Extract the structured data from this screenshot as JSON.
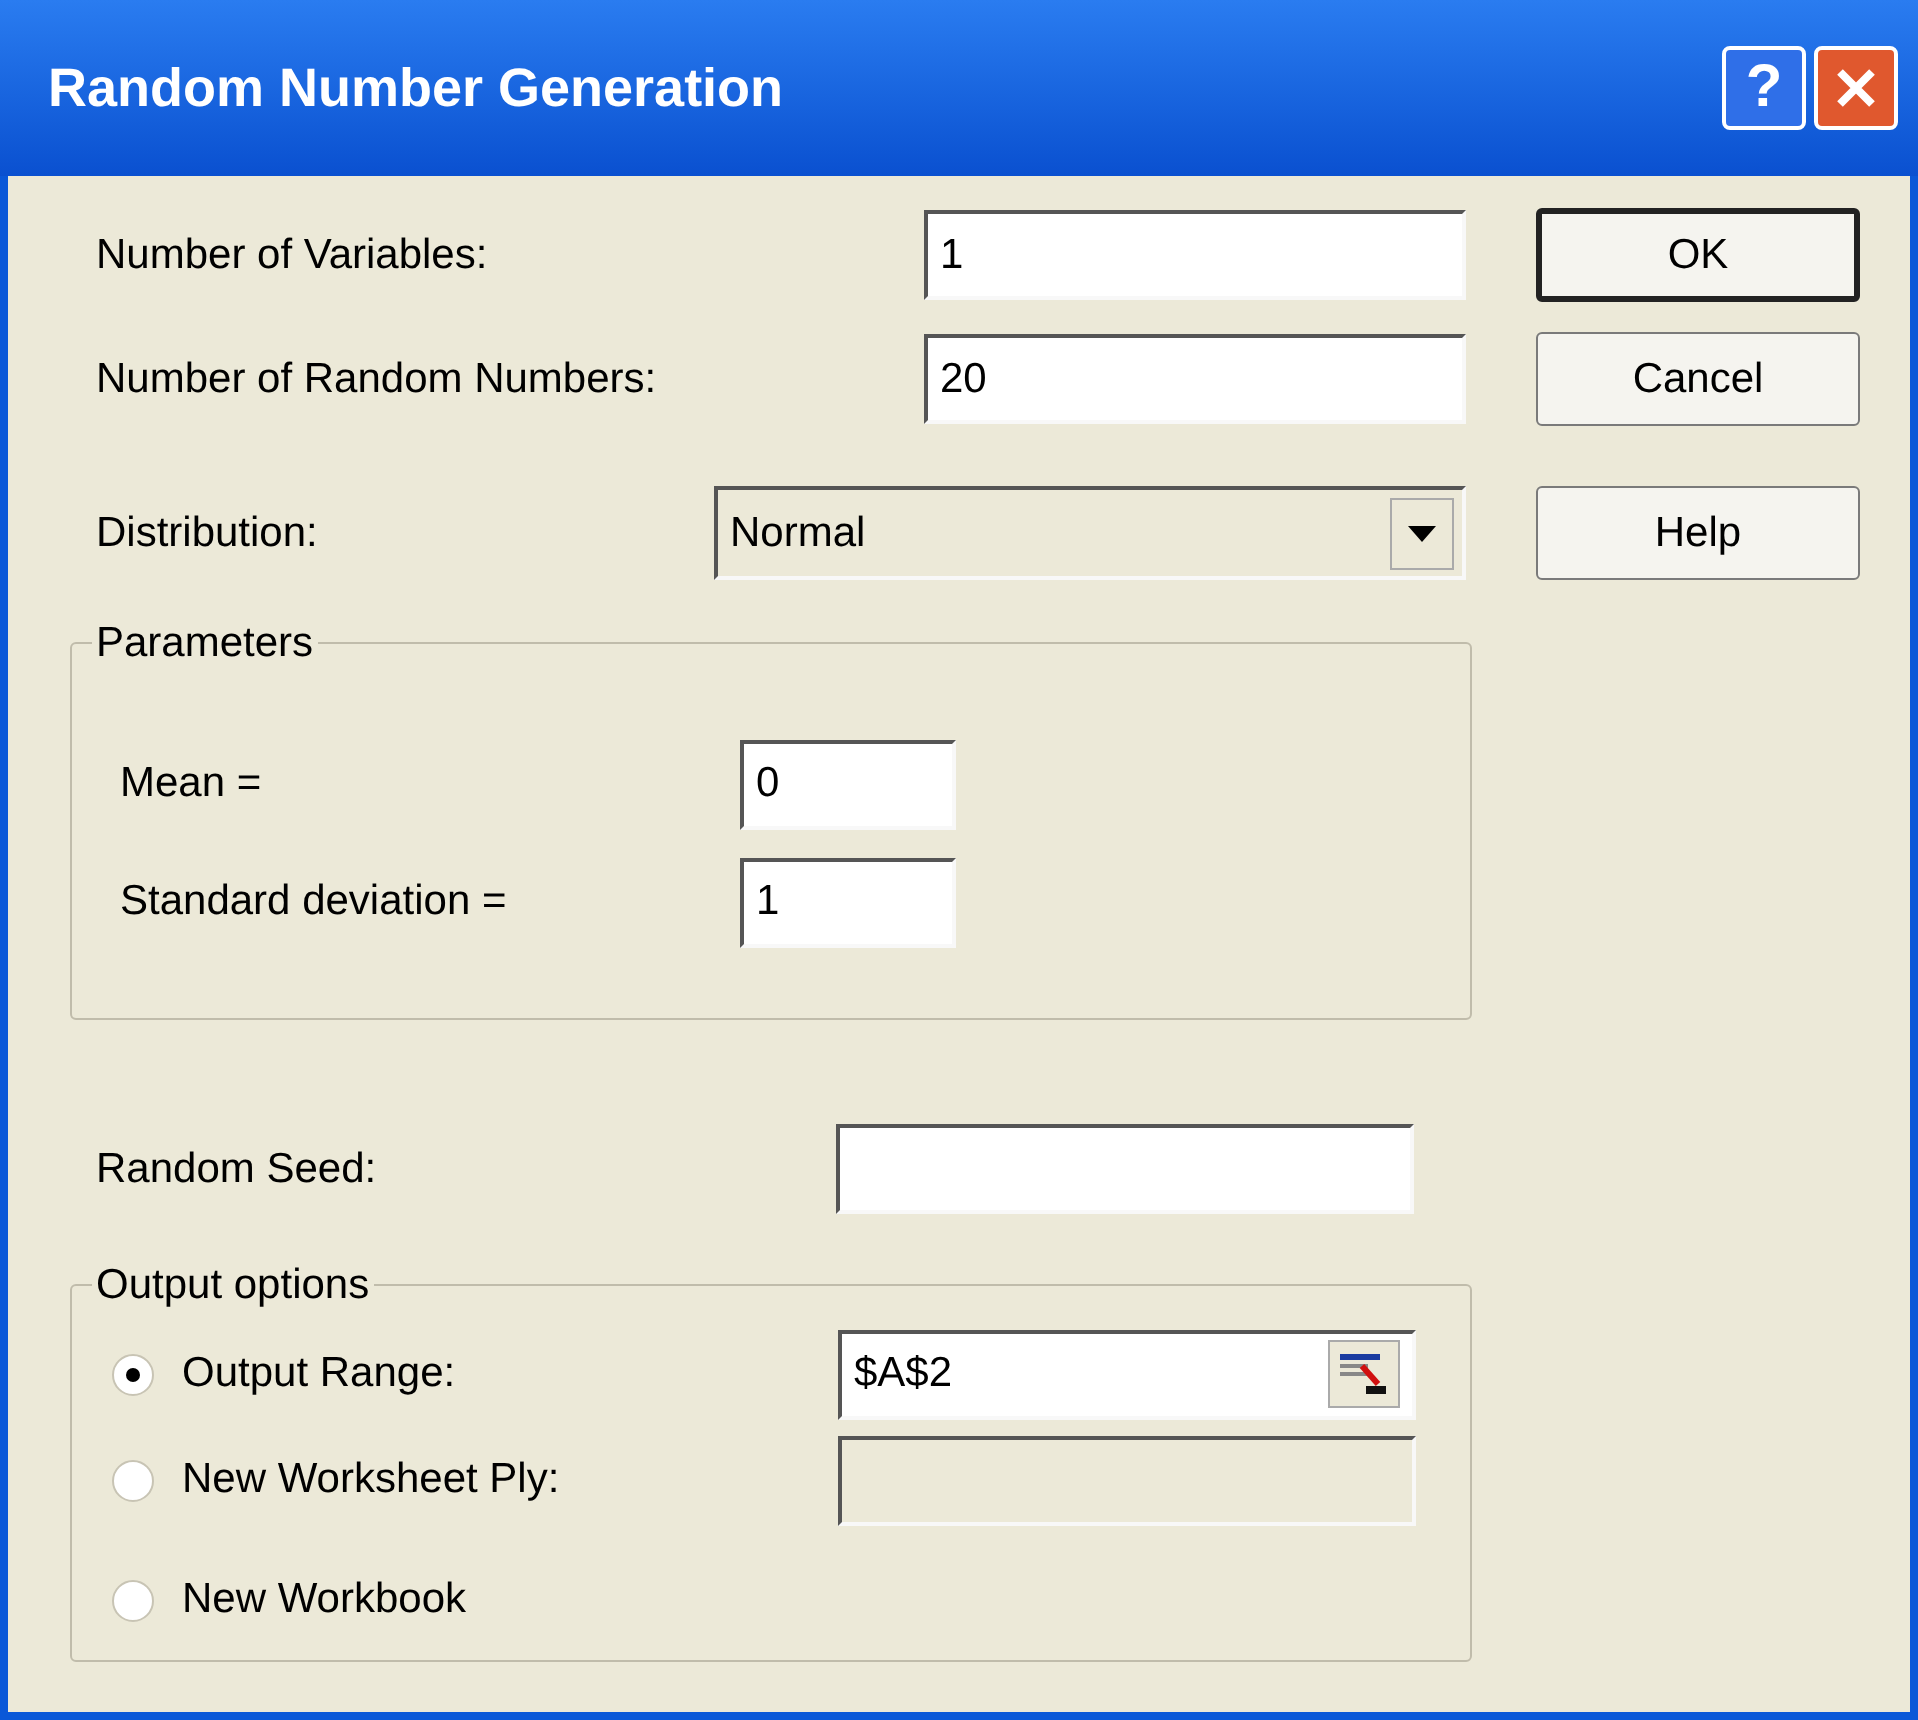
{
  "window": {
    "title": "Random Number Generation"
  },
  "title_buttons": [
    {
      "kind": "help",
      "symbol": "?"
    },
    {
      "kind": "close"
    }
  ],
  "inputs": [
    {
      "label": "Number of Variables:",
      "value": "1"
    },
    {
      "label": "Number of Random Numbers:",
      "value": "20"
    }
  ],
  "distribution": {
    "label": "Distribution:",
    "value": "Normal"
  },
  "parameters": {
    "title": "Parameters",
    "fields": [
      {
        "label": "Mean =",
        "value": "0"
      },
      {
        "label": "Standard deviation =",
        "value": "1"
      }
    ]
  },
  "random_seed": {
    "label": "Random Seed:"
  },
  "output_options": {
    "title": "Output options",
    "options": [
      {
        "label": "Output Range:",
        "selected": true,
        "field": {
          "value": "$A$2",
          "disabled": false,
          "ref_button": true
        }
      },
      {
        "label": "New Worksheet Ply:",
        "selected": false,
        "field": {
          "disabled": true,
          "ref_button": false
        }
      },
      {
        "label": "New Workbook",
        "selected": false
      }
    ]
  },
  "buttons": [
    {
      "label": "OK",
      "default": true
    },
    {
      "label": "Cancel",
      "default": false
    },
    {
      "label": "Help",
      "default": false
    }
  ]
}
